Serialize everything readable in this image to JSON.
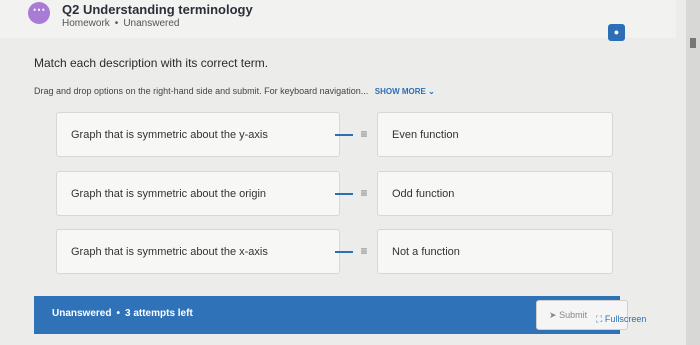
{
  "question": {
    "title": "Q2 Understanding terminology",
    "category": "Homework",
    "status": "Unanswered",
    "dot": "•"
  },
  "prompt": {
    "main": "Match each description with its correct term.",
    "instructions": "Drag and drop options on the right-hand side and submit. For keyboard navigation...",
    "show_more": "SHOW MORE"
  },
  "items": [
    {
      "left": "Graph that is symmetric about the y-axis",
      "right": "Even function"
    },
    {
      "left": "Graph that is symmetric about the origin",
      "right": "Odd function"
    },
    {
      "left": "Graph that is symmetric about the x-axis",
      "right": "Not a function"
    }
  ],
  "footer": {
    "status": "Unanswered",
    "attempts": "3 attempts left",
    "submit_label": "Submit"
  },
  "fullscreen_label": "Fullscreen",
  "icons": {
    "avatar": "more-icon",
    "info": "info-icon",
    "handle": "drag-handle-icon",
    "submit": "send-icon",
    "fullscreen": "fullscreen-icon"
  },
  "colors": {
    "accent": "#2f72b8",
    "avatar": "#a77bd6"
  }
}
